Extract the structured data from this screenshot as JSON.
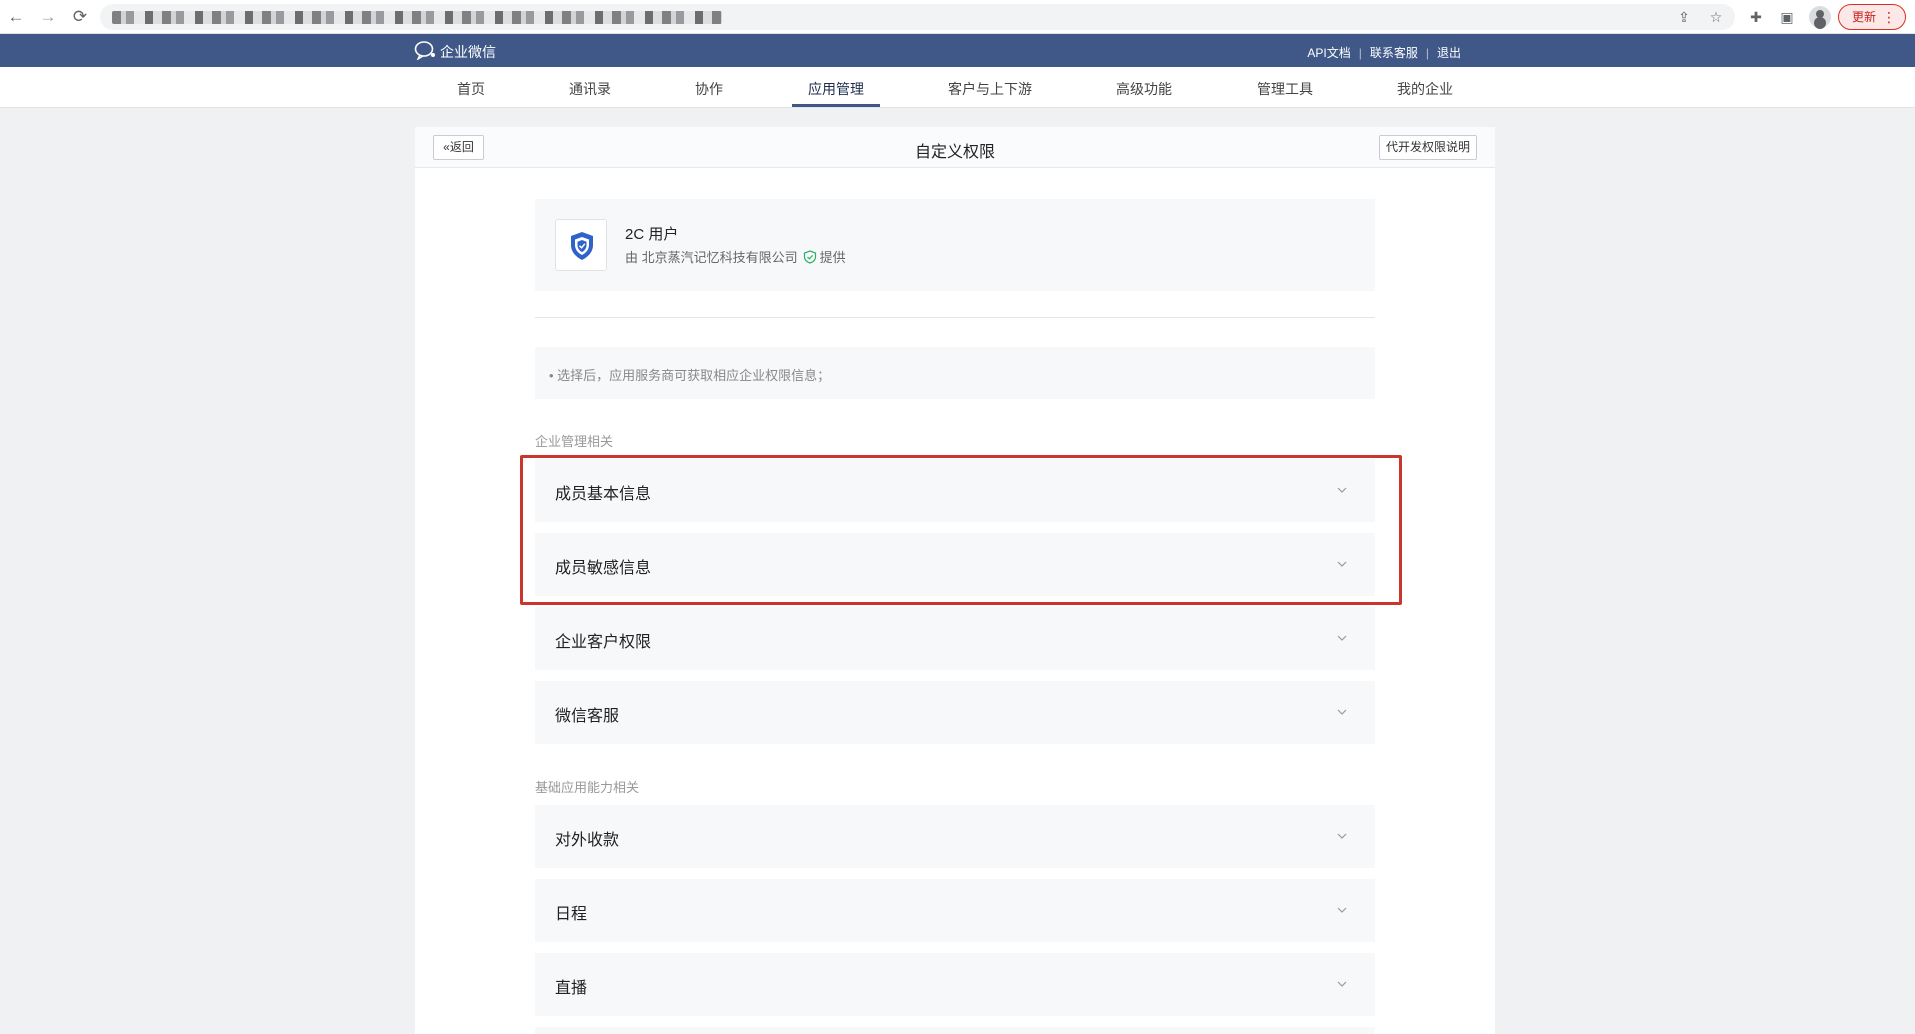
{
  "browser": {
    "back_icon": "arrow-left-icon",
    "forward_icon": "arrow-right-icon",
    "reload_icon": "reload-icon",
    "update_label": "更新"
  },
  "topbar": {
    "logo_text": "企业微信",
    "links": [
      "API文档",
      "联系客服",
      "退出"
    ]
  },
  "nav": {
    "items": [
      "首页",
      "通讯录",
      "协作",
      "应用管理",
      "客户与上下游",
      "高级功能",
      "管理工具",
      "我的企业"
    ],
    "active": "应用管理"
  },
  "panel": {
    "back_label": "返回",
    "title": "自定义权限",
    "explain_label": "代开发权限说明"
  },
  "app": {
    "name": "2C 用户",
    "provider_prefix": "由 北京蒸汽记忆科技有限公司",
    "provider_suffix": "提供"
  },
  "tip": "• 选择后，应用服务商可获取相应企业权限信息；",
  "sections": [
    {
      "label": "企业管理相关",
      "items": [
        "成员基本信息",
        "成员敏感信息",
        "企业客户权限",
        "微信客服"
      ]
    },
    {
      "label": "基础应用能力相关",
      "items": [
        "对外收款",
        "日程",
        "直播"
      ]
    }
  ],
  "colors": {
    "topbar": "#3f5887",
    "highlight": "#c8362c",
    "verified": "#2bae67"
  }
}
